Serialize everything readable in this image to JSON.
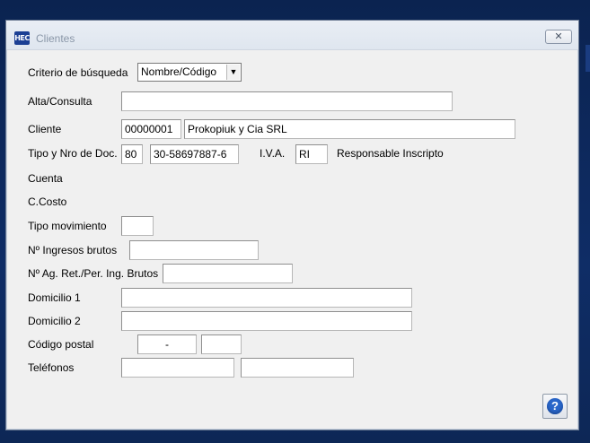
{
  "window": {
    "title": "Clientes",
    "icon_text": "HEC",
    "close_glyph": "✕",
    "help_glyph": "?"
  },
  "form": {
    "criterio_label": "Criterio de búsqueda",
    "criterio_value": "Nombre/Código",
    "alta_label": "Alta/Consulta",
    "alta_value": "",
    "cliente_label": "Cliente",
    "cliente_code": "00000001",
    "cliente_name": "Prokopiuk y Cia SRL",
    "tipo_doc_label": "Tipo y Nro de Doc.",
    "tipo_doc_value": "80",
    "nro_doc_value": "30-58697887-6",
    "iva_label": "I.V.A.",
    "iva_value": "RI",
    "iva_desc": "Responsable Inscripto",
    "cuenta_label": "Cuenta",
    "ccosto_label": "C.Costo",
    "tipo_mov_label": "Tipo movimiento",
    "tipo_mov_value": "",
    "ingresos_label": "Nº Ingresos brutos",
    "ingresos_value": "",
    "ag_ret_label": "Nº Ag. Ret./Per. Ing. Brutos",
    "ag_ret_value": "",
    "domicilio1_label": "Domicilio 1",
    "domicilio1_value": "",
    "domicilio2_label": "Domicilio 2",
    "domicilio2_value": "",
    "cp_label": "Código postal",
    "cp_value": "-",
    "cp_extra": "",
    "telefonos_label": "Teléfonos",
    "tel1_value": "",
    "tel2_value": ""
  }
}
